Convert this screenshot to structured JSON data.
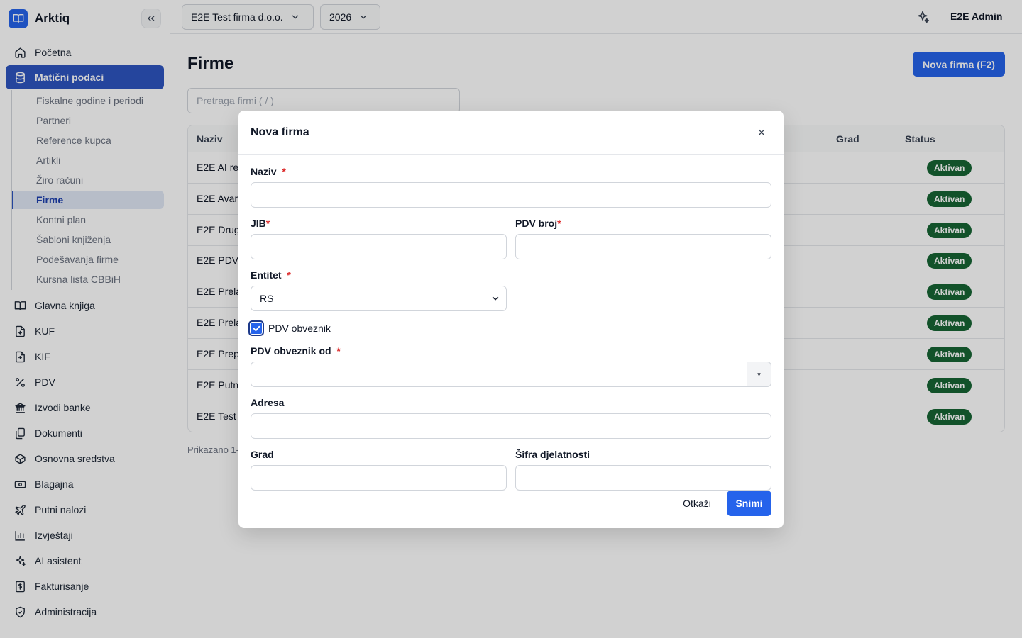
{
  "app": {
    "name": "Arktiq"
  },
  "topbar": {
    "company": "E2E Test firma d.o.o.",
    "year": "2026",
    "user": "E2E Admin"
  },
  "sidebar": {
    "items": [
      {
        "label": "Početna",
        "icon": "home-icon"
      },
      {
        "label": "Matični podaci",
        "icon": "database-icon",
        "active": true
      },
      {
        "label": "Glavna knjiga",
        "icon": "book-icon"
      },
      {
        "label": "KUF",
        "icon": "file-in-icon"
      },
      {
        "label": "KIF",
        "icon": "file-out-icon"
      },
      {
        "label": "PDV",
        "icon": "percent-icon"
      },
      {
        "label": "Izvodi banke",
        "icon": "bank-icon"
      },
      {
        "label": "Dokumenti",
        "icon": "documents-icon"
      },
      {
        "label": "Osnovna sredstva",
        "icon": "box-icon"
      },
      {
        "label": "Blagajna",
        "icon": "cash-icon"
      },
      {
        "label": "Putni nalozi",
        "icon": "plane-icon"
      },
      {
        "label": "Izvještaji",
        "icon": "chart-icon"
      },
      {
        "label": "AI asistent",
        "icon": "sparkle-icon"
      },
      {
        "label": "Fakturisanje",
        "icon": "invoice-icon"
      },
      {
        "label": "Administracija",
        "icon": "shield-icon"
      }
    ],
    "subitems": [
      {
        "label": "Fiskalne godine i periodi"
      },
      {
        "label": "Partneri"
      },
      {
        "label": "Reference kupca"
      },
      {
        "label": "Artikli"
      },
      {
        "label": "Žiro računi"
      },
      {
        "label": "Firme",
        "active": true
      },
      {
        "label": "Kontni plan"
      },
      {
        "label": "Šabloni knjiženja"
      },
      {
        "label": "Podešavanja firme"
      },
      {
        "label": "Kursna lista CBBiH"
      }
    ]
  },
  "main": {
    "title": "Firme",
    "new_button": "Nova firma (F2)",
    "search_placeholder": "Pretraga firmi ( / )",
    "table": {
      "headers": {
        "name": "Naziv",
        "city": "Grad",
        "status": "Status"
      },
      "rows": [
        {
          "name": "E2E AI re",
          "status": "Aktivan"
        },
        {
          "name": "E2E Avar",
          "status": "Aktivan"
        },
        {
          "name": "E2E Drug",
          "status": "Aktivan"
        },
        {
          "name": "E2E PDV",
          "status": "Aktivan"
        },
        {
          "name": "E2E Prela",
          "status": "Aktivan"
        },
        {
          "name": "E2E Prela",
          "status": "Aktivan"
        },
        {
          "name": "E2E Prep",
          "status": "Aktivan"
        },
        {
          "name": "E2E Putn",
          "status": "Aktivan"
        },
        {
          "name": "E2E Test",
          "status": "Aktivan"
        }
      ]
    },
    "footer": "Prikazano 1-"
  },
  "modal": {
    "title": "Nova firma",
    "close": "×",
    "fields": {
      "naziv": {
        "label": "Naziv",
        "value": ""
      },
      "jib": {
        "label": "JIB",
        "value": ""
      },
      "pdv_broj": {
        "label": "PDV broj",
        "value": ""
      },
      "entitet": {
        "label": "Entitet",
        "value": "RS"
      },
      "pdv_obveznik": {
        "label": "PDV obveznik",
        "checked": true
      },
      "pdv_obveznik_od": {
        "label": "PDV obveznik od",
        "value": ""
      },
      "adresa": {
        "label": "Adresa",
        "value": ""
      },
      "grad": {
        "label": "Grad",
        "value": ""
      },
      "sifra_djelatnosti": {
        "label": "Šifra djelatnosti",
        "value": ""
      }
    },
    "required_mark": "*",
    "date_toggle": "▾",
    "cancel": "Otkaži",
    "save": "Snimi"
  },
  "colors": {
    "primary": "#2563eb",
    "sidebar_active": "#2e55c0",
    "badge_green": "#166534",
    "required_red": "#dc2626"
  }
}
